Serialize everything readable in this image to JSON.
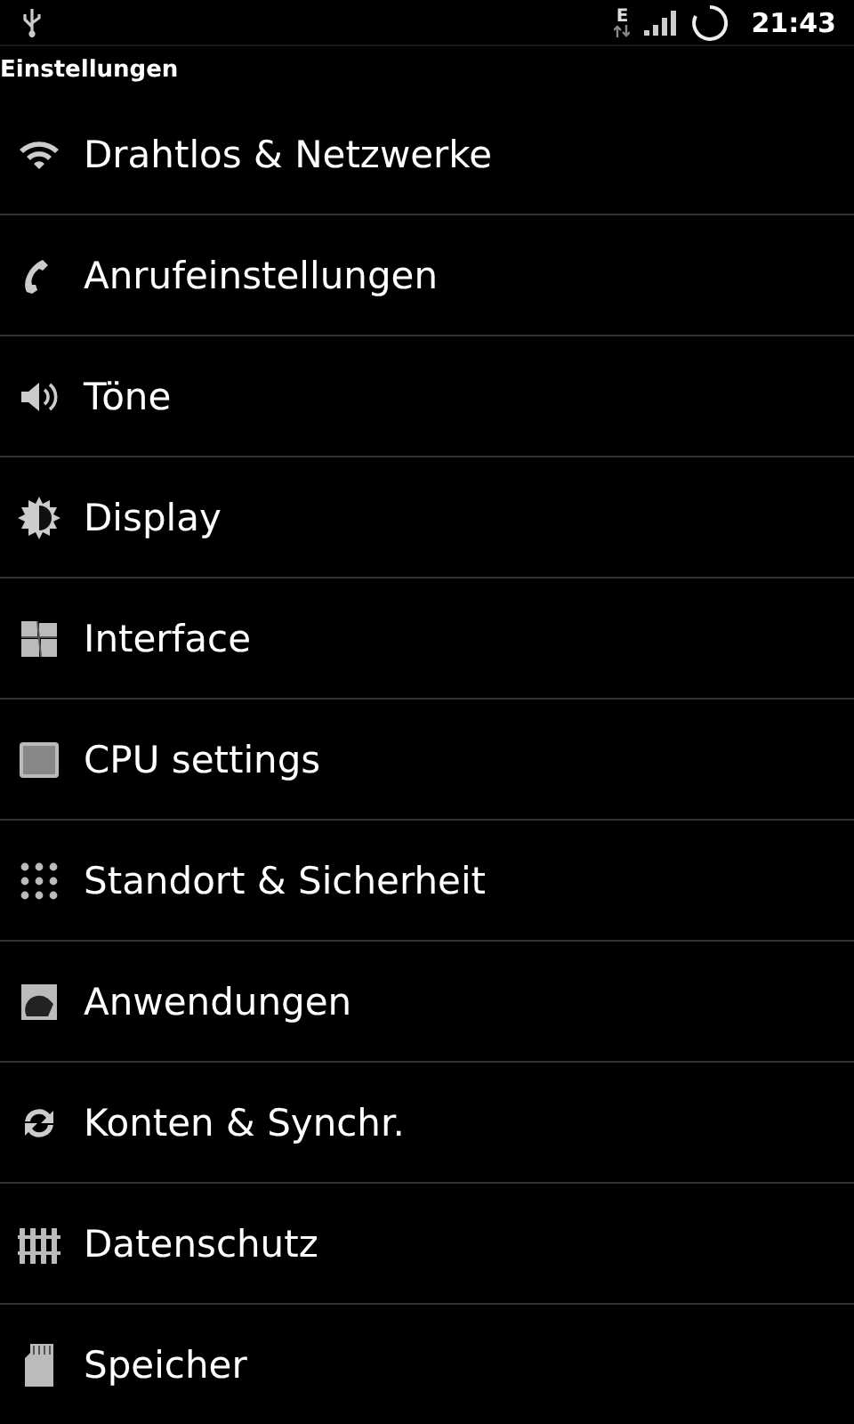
{
  "status_bar": {
    "network_type": "E",
    "time": "21:43"
  },
  "title": "Einstellungen",
  "items": [
    {
      "label": "Drahtlos & Netzwerke"
    },
    {
      "label": "Anrufeinstellungen"
    },
    {
      "label": "Töne"
    },
    {
      "label": "Display"
    },
    {
      "label": "Interface"
    },
    {
      "label": "CPU settings"
    },
    {
      "label": "Standort & Sicherheit"
    },
    {
      "label": "Anwendungen"
    },
    {
      "label": "Konten & Synchr."
    },
    {
      "label": "Datenschutz"
    },
    {
      "label": "Speicher"
    }
  ]
}
